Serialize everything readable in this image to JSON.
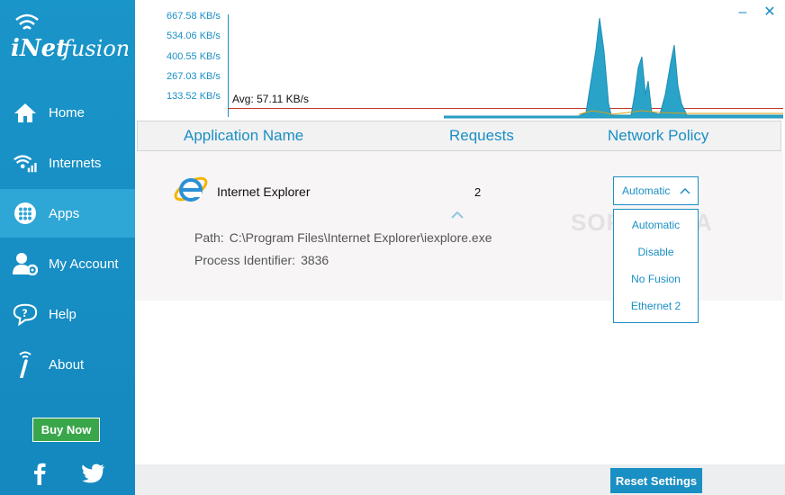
{
  "app": {
    "logo_text": "iNetfusion"
  },
  "sidebar": {
    "items": [
      {
        "label": "Home",
        "icon": "home-icon"
      },
      {
        "label": "Internets",
        "icon": "wifi-signal-icon"
      },
      {
        "label": "Apps",
        "icon": "apps-grid-icon"
      },
      {
        "label": "My Account",
        "icon": "account-icon"
      },
      {
        "label": "Help",
        "icon": "help-chat-icon"
      },
      {
        "label": "About",
        "icon": "about-info-icon"
      }
    ],
    "buy_label": "Buy Now",
    "social": [
      "facebook-icon",
      "twitter-icon"
    ]
  },
  "graph": {
    "ticks": [
      "667.58 KB/s",
      "534.06 KB/s",
      "400.55 KB/s",
      "267.03 KB/s",
      "133.52 KB/s"
    ],
    "avg_label": "Avg: 57.11 KB/s",
    "colors": {
      "fill": "#2aa3c8",
      "avg_line": "#c0392b",
      "axis": "#1a8fc4"
    }
  },
  "window": {
    "minimize": "–",
    "close": "✕"
  },
  "table": {
    "headers": {
      "name": "Application Name",
      "requests": "Requests",
      "policy": "Network Policy"
    },
    "rows": [
      {
        "name": "Internet Explorer",
        "requests": "2",
        "policy": "Automatic",
        "path_label": "Path:",
        "path": "C:\\Program Files\\Internet Explorer\\iexplore.exe",
        "pid_label": "Process Identifier:",
        "pid": "3836"
      }
    ]
  },
  "policy_options": [
    "Automatic",
    "Disable",
    "No Fusion",
    "Ethernet 2"
  ],
  "watermark": "SOFTPEDIA",
  "footer": {
    "reset_label": "Reset Settings"
  },
  "accent_color": "#1a8fc4"
}
